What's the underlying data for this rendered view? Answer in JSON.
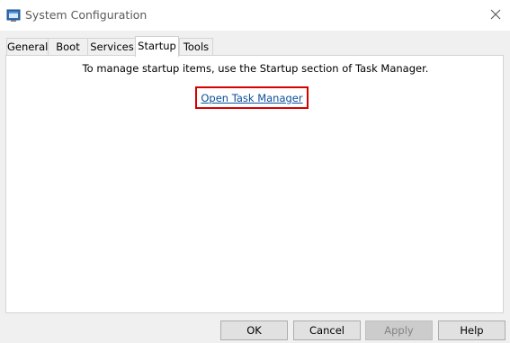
{
  "window": {
    "title": "System Configuration",
    "icon": "settings-app-icon",
    "close_icon": "close-icon"
  },
  "tabs": [
    {
      "label": "General",
      "active": false
    },
    {
      "label": "Boot",
      "active": false
    },
    {
      "label": "Services",
      "active": false
    },
    {
      "label": "Startup",
      "active": true
    },
    {
      "label": "Tools",
      "active": false
    }
  ],
  "startup": {
    "info_text": "To manage startup items, use the Startup section of Task Manager.",
    "link_label": "Open Task Manager",
    "link_color": "#0b4f9a",
    "highlight_color": "#d70000"
  },
  "buttons": {
    "ok": "OK",
    "cancel": "Cancel",
    "apply": "Apply",
    "apply_disabled": true,
    "help": "Help"
  }
}
